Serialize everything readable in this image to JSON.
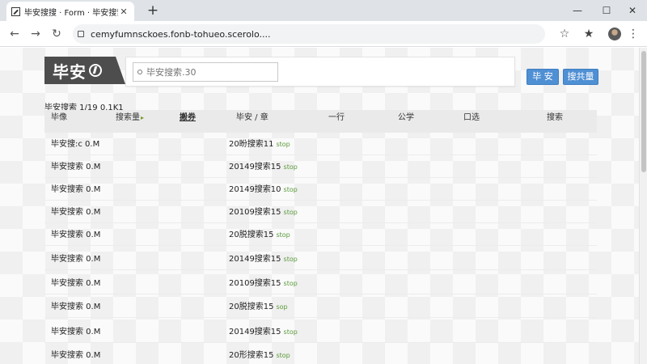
{
  "browser": {
    "tab_title": "毕安搜搜 · Form · 毕安搜索",
    "url": "cemyfumnsckoes.fonb-tohueo.scerolo....",
    "colors": {
      "tabbar": "#dfe3e8",
      "omnibox": "#f1f3f4"
    }
  },
  "site": {
    "logo_text": "毕安",
    "search_placeholder": "毕安搜索.30",
    "buttons": {
      "primary": "毕 安",
      "secondary": "搜共量"
    },
    "accent": "#4f8fd3"
  },
  "table": {
    "summary": "毕安搜索 1/19 0.1K1",
    "headers": [
      "毕像",
      "搜索量",
      "搬券",
      "毕安 / 章",
      "一行",
      "公学",
      "口选",
      "搜索"
    ],
    "sort_indicator": "▸",
    "rows": [
      {
        "name": "毕安搜:c 0.M",
        "date": "20盼搜索11",
        "tag": "stop"
      },
      {
        "name": "毕安搜索 0.M",
        "date": "20149搜索15",
        "tag": "stop"
      },
      {
        "name": "毕安搜索 0.M",
        "date": "20149搜索10",
        "tag": "stop"
      },
      {
        "name": "毕安搜索 0.M",
        "date": "20109搜索15",
        "tag": "stop"
      },
      {
        "name": "毕安搜索 0.M",
        "date": "20脱搜索15",
        "tag": "stop"
      },
      {
        "name": "毕安搜索 0.M",
        "date": "20149搜索15",
        "tag": "stop"
      },
      {
        "name": "毕安搜索 0.M",
        "date": "20109搜索15",
        "tag": "stop"
      },
      {
        "name": "毕安搜索 0.M",
        "date": "20脱搜索15",
        "tag": "sop"
      },
      {
        "name": "毕安搜索 0.M",
        "date": "20149搜索15",
        "tag": "stop"
      },
      {
        "name": "毕安搜索 0.M",
        "date": "20形搜索15",
        "tag": "stop"
      }
    ]
  }
}
